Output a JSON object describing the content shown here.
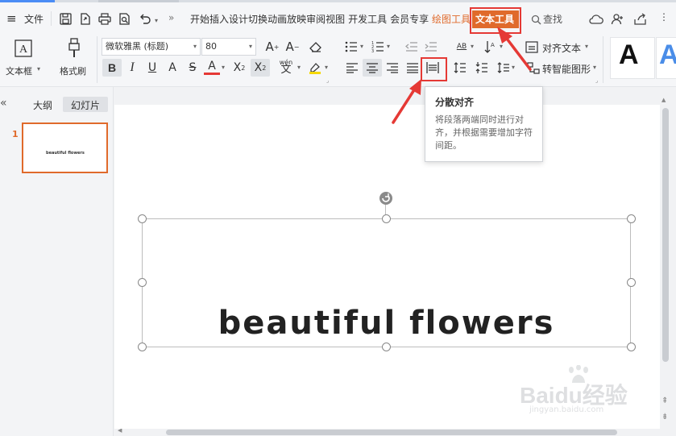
{
  "menubar": {
    "hamburger_label": "≡",
    "file_label": "文件",
    "more_label": "»",
    "tabs": [
      "开始",
      "插入",
      "设计",
      "切换",
      "动画",
      "放映",
      "审阅",
      "视图",
      "开发工具",
      "会员专享"
    ],
    "drawing_tools_label": "绘图工具",
    "text_tools_label": "文本工具",
    "search_label": "查找"
  },
  "ribbon": {
    "textbox_label": "文本框",
    "format_painter_label": "格式刷",
    "font_name": "微软雅黑 (标题)",
    "font_size": "80",
    "align_text_label": "对齐文本",
    "smartart_label": "转智能图形",
    "wen_label": "wén",
    "ab_label": "AB",
    "style_a_black": "A",
    "style_a_blue": "A"
  },
  "panel": {
    "collapse_label": "«",
    "outline_tab": "大纲",
    "slides_tab": "幻灯片",
    "slide_number": "1",
    "thumb_text": "beautiful flowers"
  },
  "slide": {
    "title_text": "beautiful flowers"
  },
  "tooltip": {
    "title": "分散对齐",
    "body": "将段落两端同时进行对齐，并根据需要增加字符间距。"
  },
  "watermark": {
    "logo_text": "Baidu经验",
    "url": "jingyan.baidu.com"
  },
  "colors": {
    "accent_red": "#e53935",
    "brand_orange": "#e06a2b",
    "style_blue": "#4a8de8"
  }
}
